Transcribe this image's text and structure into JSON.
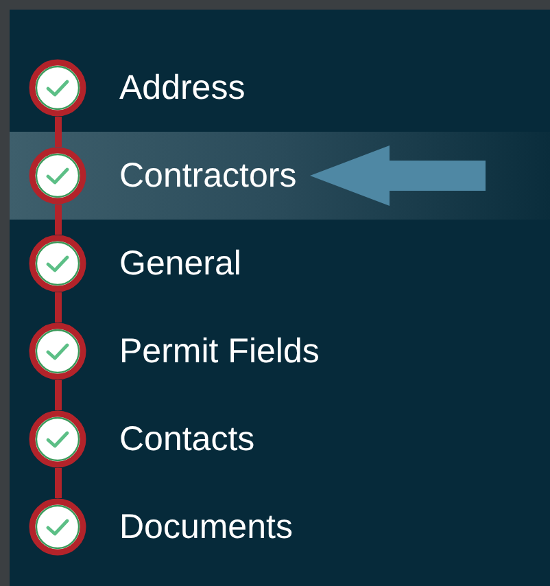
{
  "steps": [
    {
      "label": "Address",
      "completed": true,
      "selected": false
    },
    {
      "label": "Contractors",
      "completed": true,
      "selected": true
    },
    {
      "label": "General",
      "completed": true,
      "selected": false
    },
    {
      "label": "Permit Fields",
      "completed": true,
      "selected": false
    },
    {
      "label": "Contacts",
      "completed": true,
      "selected": false
    },
    {
      "label": "Documents",
      "completed": true,
      "selected": false
    }
  ]
}
